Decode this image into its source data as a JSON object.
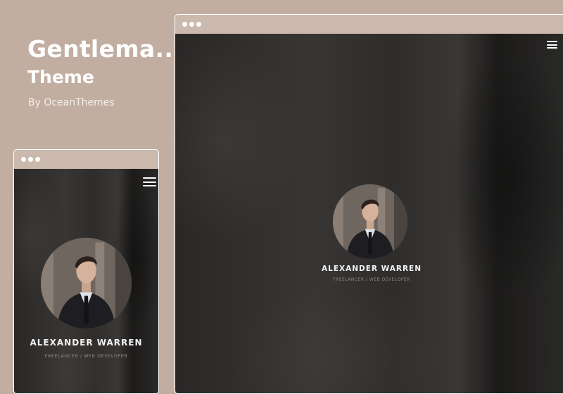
{
  "theme": {
    "title": "Gentlema..",
    "subtitle": "Theme",
    "author": "By OceanThemes"
  },
  "colors": {
    "background": "#c2aea1",
    "window_bar": "#cbb9ae",
    "screen": "#2f2d2b",
    "text_light": "#ffffff"
  },
  "desktop_preview": {
    "menu_icon": "hamburger-menu-icon",
    "profile": {
      "name": "ALEXANDER WARREN",
      "role": "FREELANCER / WEB DEVELOPER"
    }
  },
  "mobile_preview": {
    "menu_icon": "hamburger-menu-icon",
    "profile": {
      "name": "ALEXANDER WARREN",
      "role": "FREELANCER / WEB DEVELOPER"
    }
  }
}
